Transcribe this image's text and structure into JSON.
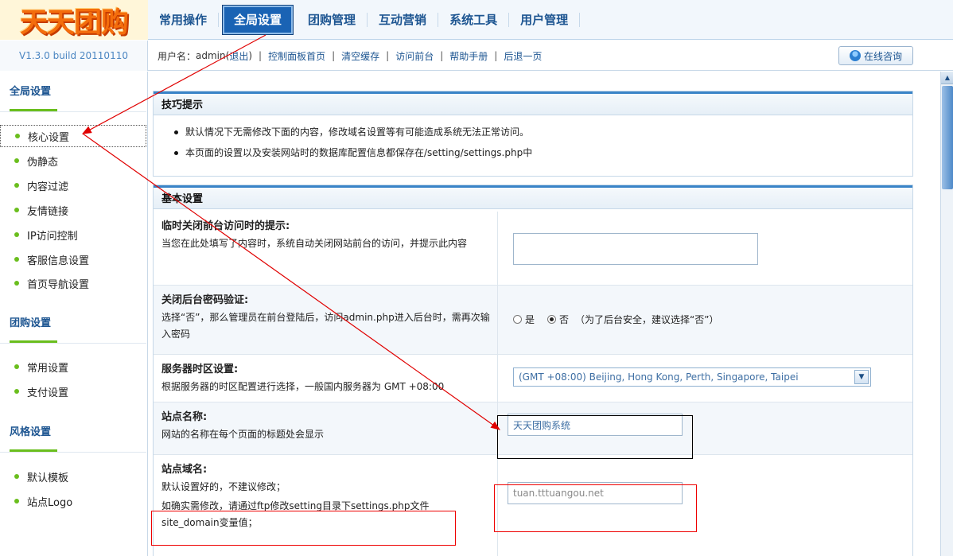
{
  "brand": {
    "logo_text": "天天团购",
    "version": "V1.3.0 build 20110110"
  },
  "top_nav": {
    "items": [
      {
        "label": "常用操作"
      },
      {
        "label": "全局设置"
      },
      {
        "label": "团购管理"
      },
      {
        "label": "互动营销"
      },
      {
        "label": "系统工具"
      },
      {
        "label": "用户管理"
      }
    ],
    "active": "全局设置"
  },
  "sub_bar": {
    "user_prefix": "用户名：",
    "username": "admin",
    "logout": "退出",
    "links": [
      "控制面板首页",
      "清空缓存",
      "访问前台",
      "帮助手册",
      "后退一页"
    ],
    "online_consult": "在线咨询"
  },
  "sidebar": {
    "groups": [
      {
        "title": "全局设置",
        "items": [
          "核心设置",
          "伪静态",
          "内容过滤",
          "友情链接",
          "IP访问控制",
          "客服信息设置",
          "首页导航设置"
        ]
      },
      {
        "title": "团购设置",
        "items": [
          "常用设置",
          "支付设置"
        ]
      },
      {
        "title": "风格设置",
        "items": [
          "默认模板",
          "站点Logo"
        ]
      }
    ],
    "selected": "核心设置"
  },
  "tips": {
    "title": "技巧提示",
    "items": [
      "默认情况下无需修改下面的内容，修改域名设置等有可能造成系统无法正常访问。",
      "本页面的设置以及安装网站时的数据库配置信息都保存在/setting/settings.php中"
    ]
  },
  "basic": {
    "title": "基本设置",
    "rows": [
      {
        "label": "临时关闭前台访问时的提示:",
        "desc": "当您在此处填写了内容时，系统自动关闭网站前台的访问，并提示此内容",
        "value": ""
      },
      {
        "label": "关闭后台密码验证:",
        "desc": "选择“否”，那么管理员在前台登陆后，访问admin.php进入后台时，需再次输入密码",
        "option_yes": "是",
        "option_no": "否",
        "note": "（为了后台安全，建议选择“否”）",
        "selected": "否"
      },
      {
        "label": "服务器时区设置:",
        "desc": "根据服务器的时区配置进行选择，一般国内服务器为 GMT +08:00",
        "value": "(GMT +08:00) Beijing, Hong Kong, Perth, Singapore, Taipei"
      },
      {
        "label": "站点名称:",
        "desc": "网站的名称在每个页面的标题处会显示",
        "value": "天天团购系统"
      },
      {
        "label": "站点域名:",
        "desc": "默认设置好的，不建议修改；",
        "desc2": "如确实需修改，请通过ftp修改setting目录下settings.php文件",
        "desc3": "site_domain变量值；",
        "value": "tuan.tttuangou.net"
      }
    ]
  },
  "colors": {
    "accent": "#1a63b4",
    "green": "#6abe1d",
    "annotation": "#e00000"
  }
}
